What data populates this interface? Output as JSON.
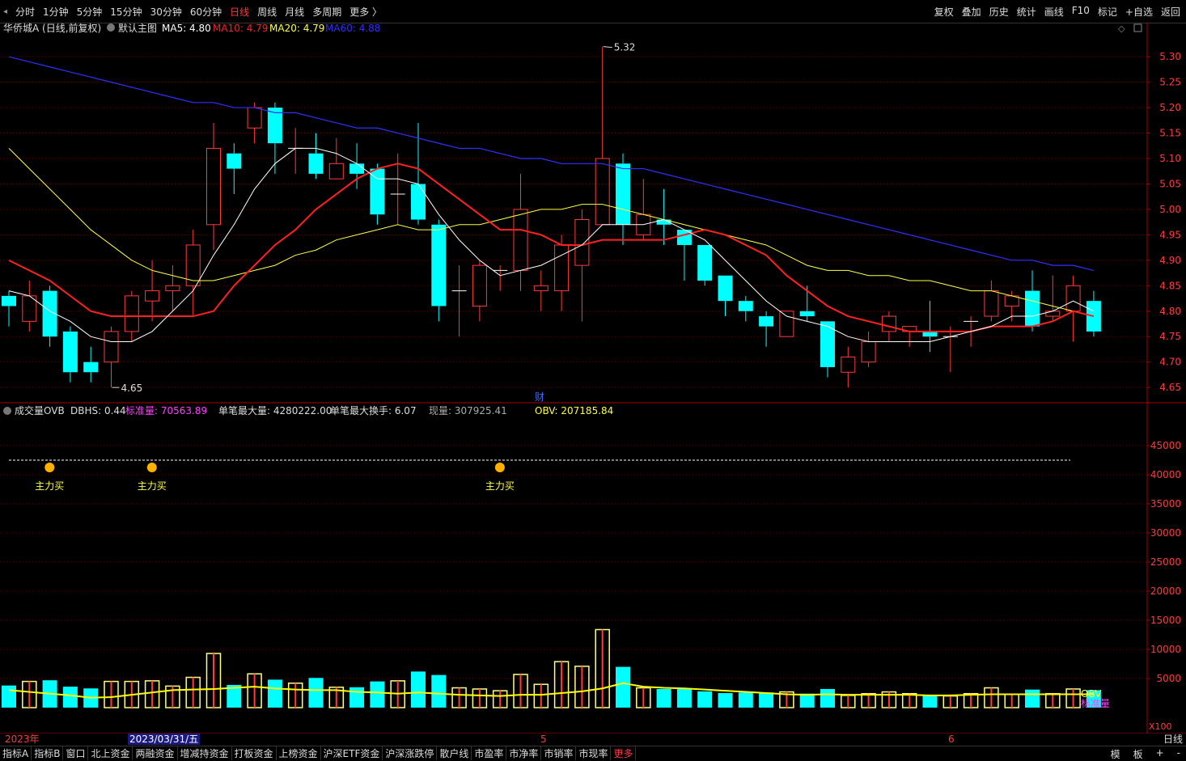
{
  "topbar": {
    "periods": [
      {
        "label": "分时",
        "active": false
      },
      {
        "label": "1分钟",
        "active": false
      },
      {
        "label": "5分钟",
        "active": false
      },
      {
        "label": "15分钟",
        "active": false
      },
      {
        "label": "30分钟",
        "active": false
      },
      {
        "label": "60分钟",
        "active": false
      },
      {
        "label": "日线",
        "active": true
      },
      {
        "label": "周线",
        "active": false
      },
      {
        "label": "月线",
        "active": false
      },
      {
        "label": "多周期",
        "active": false
      },
      {
        "label": "更多 〉",
        "active": false
      }
    ],
    "tools": [
      "复权",
      "叠加",
      "历史",
      "统计",
      "画线",
      "F10",
      "标记",
      "+自选",
      "返回"
    ]
  },
  "price_panel": {
    "title": "华侨城A (日线,前复权)",
    "template": "默认主图",
    "ma_labels": [
      {
        "text": "MA5: 4.80",
        "color": "#ffffff"
      },
      {
        "text": "MA10: 4.79",
        "color": "#ff2020"
      },
      {
        "text": "MA20: 4.79",
        "color": "#ffff40"
      },
      {
        "text": "MA60: 4.88",
        "color": "#3030ff"
      }
    ],
    "high_label": "5.32",
    "low_label": "4.65",
    "finance_marker": "财"
  },
  "volume_panel": {
    "title": "成交量OVB",
    "dbhs": "DBHS: 0.44",
    "std_vol": "标准量: 70563.89",
    "max_single": "单笔最大量: 4280222.00",
    "max_turnover": "单笔最大换手: 6.07",
    "current": "现量: 307925.41",
    "obv": "OBV: 207185.84",
    "signal_label": "主力买",
    "obv_tag": "OBV",
    "std_tag": "标准量",
    "scale_tag": "X100"
  },
  "time_axis": {
    "labels": [
      "2023年",
      "2023/03/31/五",
      "5",
      "6"
    ],
    "period_tag": "日线"
  },
  "bottombar": {
    "items": [
      "指标A",
      "指标B",
      "窗口",
      "北上资金",
      "两融资金",
      "增减持资金",
      "打板资金",
      "上榜资金",
      "沪深ETF资金",
      "沪深涨跌停",
      "散户线",
      "市盈率",
      "市净率",
      "市销率",
      "市现率"
    ],
    "more": "更多",
    "right": [
      "模",
      "板",
      "+",
      "-"
    ]
  },
  "colors": {
    "up": "#ff3b3b",
    "down": "#00ffff",
    "ma5": "#ffffff",
    "ma10": "#ff2020",
    "ma20": "#ffff40",
    "ma60": "#3030ff",
    "axis": "#aa0000",
    "vol_up_fill": "#ffff80"
  },
  "chart_data": {
    "type": "candlestick",
    "price_axis": {
      "ticks": [
        4.65,
        4.7,
        4.75,
        4.8,
        4.85,
        4.9,
        4.95,
        5.0,
        5.05,
        5.1,
        5.15,
        5.2,
        5.25,
        5.3
      ],
      "range": [
        4.62,
        5.34
      ]
    },
    "volume_axis": {
      "ticks": [
        5000,
        10000,
        15000,
        20000,
        25000,
        30000,
        35000,
        40000,
        45000
      ],
      "range": [
        0,
        50000
      ],
      "unit": "X100"
    },
    "candles": [
      [
        4.83,
        4.81,
        4.84,
        4.77
      ],
      [
        4.78,
        4.83,
        4.86,
        4.76
      ],
      [
        4.84,
        4.75,
        4.85,
        4.73
      ],
      [
        4.76,
        4.68,
        4.77,
        4.66
      ],
      [
        4.7,
        4.68,
        4.73,
        4.66
      ],
      [
        4.7,
        4.76,
        4.77,
        4.65
      ],
      [
        4.76,
        4.83,
        4.84,
        4.74
      ],
      [
        4.82,
        4.84,
        4.9,
        4.78
      ],
      [
        4.84,
        4.85,
        4.89,
        4.8
      ],
      [
        4.85,
        4.93,
        4.96,
        4.79
      ],
      [
        4.97,
        5.12,
        5.17,
        4.92
      ],
      [
        5.11,
        5.08,
        5.13,
        5.03
      ],
      [
        5.16,
        5.2,
        5.21,
        5.13
      ],
      [
        5.2,
        5.13,
        5.21,
        5.07
      ],
      [
        5.12,
        5.12,
        5.16,
        5.07
      ],
      [
        5.11,
        5.07,
        5.15,
        5.06
      ],
      [
        5.06,
        5.09,
        5.14,
        5.06
      ],
      [
        5.09,
        5.07,
        5.13,
        5.04
      ],
      [
        5.08,
        4.99,
        5.09,
        4.97
      ],
      [
        5.03,
        5.03,
        5.11,
        4.97
      ],
      [
        5.05,
        4.98,
        5.17,
        4.97
      ],
      [
        4.97,
        4.81,
        4.98,
        4.78
      ],
      [
        4.84,
        4.84,
        4.89,
        4.75
      ],
      [
        4.81,
        4.89,
        4.9,
        4.78
      ],
      [
        4.88,
        4.88,
        4.89,
        4.84
      ],
      [
        4.88,
        5.0,
        5.07,
        4.84
      ],
      [
        4.84,
        4.85,
        4.88,
        4.8
      ],
      [
        4.84,
        4.93,
        4.95,
        4.8
      ],
      [
        4.89,
        4.98,
        5.0,
        4.78
      ],
      [
        4.97,
        5.1,
        5.32,
        4.97
      ],
      [
        5.09,
        4.97,
        5.11,
        4.93
      ],
      [
        4.95,
        4.99,
        5.06,
        4.94
      ],
      [
        4.98,
        4.97,
        5.04,
        4.93
      ],
      [
        4.96,
        4.93,
        4.96,
        4.86
      ],
      [
        4.93,
        4.86,
        4.93,
        4.85
      ],
      [
        4.87,
        4.82,
        4.87,
        4.79
      ],
      [
        4.82,
        4.8,
        4.83,
        4.78
      ],
      [
        4.79,
        4.77,
        4.8,
        4.73
      ],
      [
        4.75,
        4.8,
        4.8,
        4.75
      ],
      [
        4.8,
        4.79,
        4.85,
        4.78
      ],
      [
        4.78,
        4.69,
        4.78,
        4.67
      ],
      [
        4.68,
        4.71,
        4.73,
        4.65
      ],
      [
        4.7,
        4.74,
        4.76,
        4.69
      ],
      [
        4.76,
        4.79,
        4.8,
        4.74
      ],
      [
        4.76,
        4.77,
        4.77,
        4.73
      ],
      [
        4.76,
        4.75,
        4.82,
        4.72
      ],
      [
        4.75,
        4.75,
        4.77,
        4.68
      ],
      [
        4.78,
        4.78,
        4.79,
        4.73
      ],
      [
        4.79,
        4.84,
        4.86,
        4.78
      ],
      [
        4.81,
        4.83,
        4.84,
        4.78
      ],
      [
        4.84,
        4.77,
        4.88,
        4.76
      ],
      [
        4.79,
        4.8,
        4.87,
        4.78
      ],
      [
        4.8,
        4.85,
        4.87,
        4.74
      ],
      [
        4.82,
        4.76,
        4.84,
        4.75
      ]
    ],
    "ma5": [
      4.84,
      4.83,
      4.8,
      4.78,
      4.75,
      4.74,
      4.74,
      4.76,
      4.8,
      4.84,
      4.91,
      4.97,
      5.04,
      5.09,
      5.12,
      5.12,
      5.11,
      5.09,
      5.06,
      5.06,
      5.05,
      4.99,
      4.94,
      4.9,
      4.87,
      4.88,
      4.89,
      4.91,
      4.93,
      4.97,
      4.97,
      4.97,
      4.98,
      4.96,
      4.94,
      4.9,
      4.86,
      4.82,
      4.79,
      4.78,
      4.77,
      4.75,
      4.74,
      4.74,
      4.74,
      4.74,
      4.75,
      4.76,
      4.77,
      4.79,
      4.79,
      4.8,
      4.82,
      4.8
    ],
    "ma10": [
      4.9,
      4.88,
      4.86,
      4.83,
      4.8,
      4.79,
      4.79,
      4.79,
      4.79,
      4.79,
      4.8,
      4.85,
      4.89,
      4.93,
      4.96,
      5.0,
      5.03,
      5.06,
      5.08,
      5.09,
      5.08,
      5.05,
      5.02,
      4.99,
      4.96,
      4.96,
      4.95,
      4.93,
      4.93,
      4.94,
      4.94,
      4.94,
      4.94,
      4.95,
      4.96,
      4.95,
      4.93,
      4.91,
      4.87,
      4.84,
      4.81,
      4.79,
      4.78,
      4.77,
      4.76,
      4.76,
      4.76,
      4.76,
      4.77,
      4.77,
      4.77,
      4.78,
      4.8,
      4.79
    ],
    "ma20": [
      5.12,
      5.08,
      5.04,
      5.0,
      4.96,
      4.93,
      4.9,
      4.88,
      4.87,
      4.86,
      4.86,
      4.87,
      4.88,
      4.89,
      4.91,
      4.92,
      4.94,
      4.95,
      4.96,
      4.97,
      4.96,
      4.96,
      4.97,
      4.97,
      4.98,
      4.99,
      5.0,
      5.0,
      5.01,
      5.01,
      5.0,
      4.99,
      4.98,
      4.97,
      4.96,
      4.95,
      4.94,
      4.93,
      4.91,
      4.89,
      4.88,
      4.88,
      4.87,
      4.87,
      4.86,
      4.86,
      4.85,
      4.84,
      4.84,
      4.83,
      4.82,
      4.81,
      4.8,
      4.79
    ],
    "ma60": [
      5.3,
      5.29,
      5.28,
      5.27,
      5.26,
      5.25,
      5.24,
      5.23,
      5.22,
      5.21,
      5.21,
      5.2,
      5.2,
      5.19,
      5.19,
      5.18,
      5.17,
      5.16,
      5.16,
      5.15,
      5.14,
      5.13,
      5.12,
      5.12,
      5.11,
      5.1,
      5.1,
      5.09,
      5.09,
      5.09,
      5.08,
      5.08,
      5.07,
      5.06,
      5.05,
      5.04,
      5.03,
      5.02,
      5.01,
      5.0,
      4.99,
      4.98,
      4.97,
      4.96,
      4.95,
      4.94,
      4.93,
      4.92,
      4.91,
      4.9,
      4.9,
      4.89,
      4.89,
      4.88
    ],
    "volumes": [
      3800,
      4500,
      4700,
      3600,
      3300,
      4500,
      4500,
      4600,
      3700,
      5200,
      9300,
      3900,
      5800,
      4800,
      4200,
      5100,
      3500,
      3500,
      4500,
      4600,
      6200,
      5600,
      3400,
      3200,
      2900,
      5700,
      4000,
      7900,
      7100,
      13400,
      7000,
      3400,
      3200,
      3300,
      2800,
      2500,
      2600,
      2600,
      2700,
      2400,
      3200,
      2100,
      2400,
      2700,
      2400,
      2200,
      2000,
      2400,
      3400,
      2300,
      3100,
      2400,
      3200,
      3000
    ],
    "volume_ma": [
      3000,
      2700,
      2400,
      2100,
      1700,
      1800,
      2200,
      2600,
      3000,
      3100,
      3200,
      3400,
      3600,
      3300,
      3100,
      3000,
      3000,
      2700,
      2600,
      2400,
      2600,
      2400,
      2200,
      2100,
      2000,
      2200,
      2200,
      2500,
      2800,
      3300,
      4200,
      3600,
      3400,
      3300,
      3100,
      2900,
      2700,
      2500,
      2300,
      2200,
      2300,
      2200,
      2200,
      2200,
      2200,
      2100,
      2100,
      2200,
      2300,
      2300,
      2300,
      2300,
      2300,
      2300
    ],
    "signals": [
      1,
      6,
      23
    ],
    "std_line": 42500
  }
}
